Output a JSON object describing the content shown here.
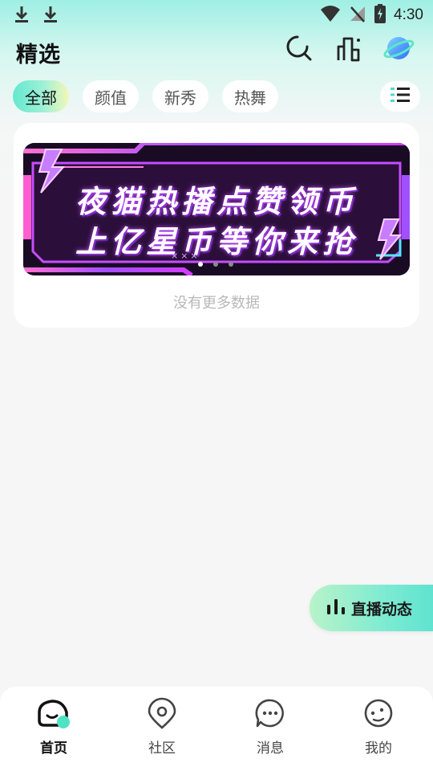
{
  "status_bar": {
    "time": "4:30",
    "icons": [
      "download-icon",
      "download-icon",
      "wifi-icon",
      "no-signal-icon",
      "battery-charging-icon"
    ]
  },
  "header": {
    "title": "精选",
    "icons": [
      "search-icon",
      "ranking-icon",
      "planet-icon"
    ]
  },
  "tabs": [
    {
      "label": "全部",
      "active": true
    },
    {
      "label": "颜值",
      "active": false
    },
    {
      "label": "新秀",
      "active": false
    },
    {
      "label": "热舞",
      "active": false
    }
  ],
  "filter_icon": "list-filter-icon",
  "banner": {
    "line1": "夜猫热播点赞领币",
    "line2": "上亿星币等你来抢",
    "decor": "×××",
    "slide_count": 3,
    "active_slide": 1
  },
  "empty_text": "没有更多数据",
  "live_button": {
    "label": "直播动态",
    "icon": "bar-chart-icon"
  },
  "bottom_nav": [
    {
      "label": "首页",
      "icon": "home-icon",
      "active": true
    },
    {
      "label": "社区",
      "icon": "community-icon",
      "active": false
    },
    {
      "label": "消息",
      "icon": "message-icon",
      "active": false
    },
    {
      "label": "我的",
      "icon": "profile-icon",
      "active": false
    }
  ],
  "colors": {
    "accent": "#5fe3d0",
    "accent_light": "#b9f3c9",
    "background": "#f6f6f6",
    "banner_bg": "#15091f",
    "banner_glow": "#c04bff"
  }
}
